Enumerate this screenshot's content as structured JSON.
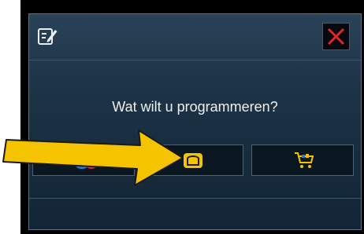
{
  "dialog": {
    "prompt": "Wat wilt u programmeren?",
    "options": [
      {
        "icon": "drinks-icon"
      },
      {
        "icon": "bread-icon",
        "selected": true
      },
      {
        "icon": "shopping-cart-icon"
      }
    ],
    "accent_yellow": "#f5c400",
    "close_color": "#e3242b"
  }
}
